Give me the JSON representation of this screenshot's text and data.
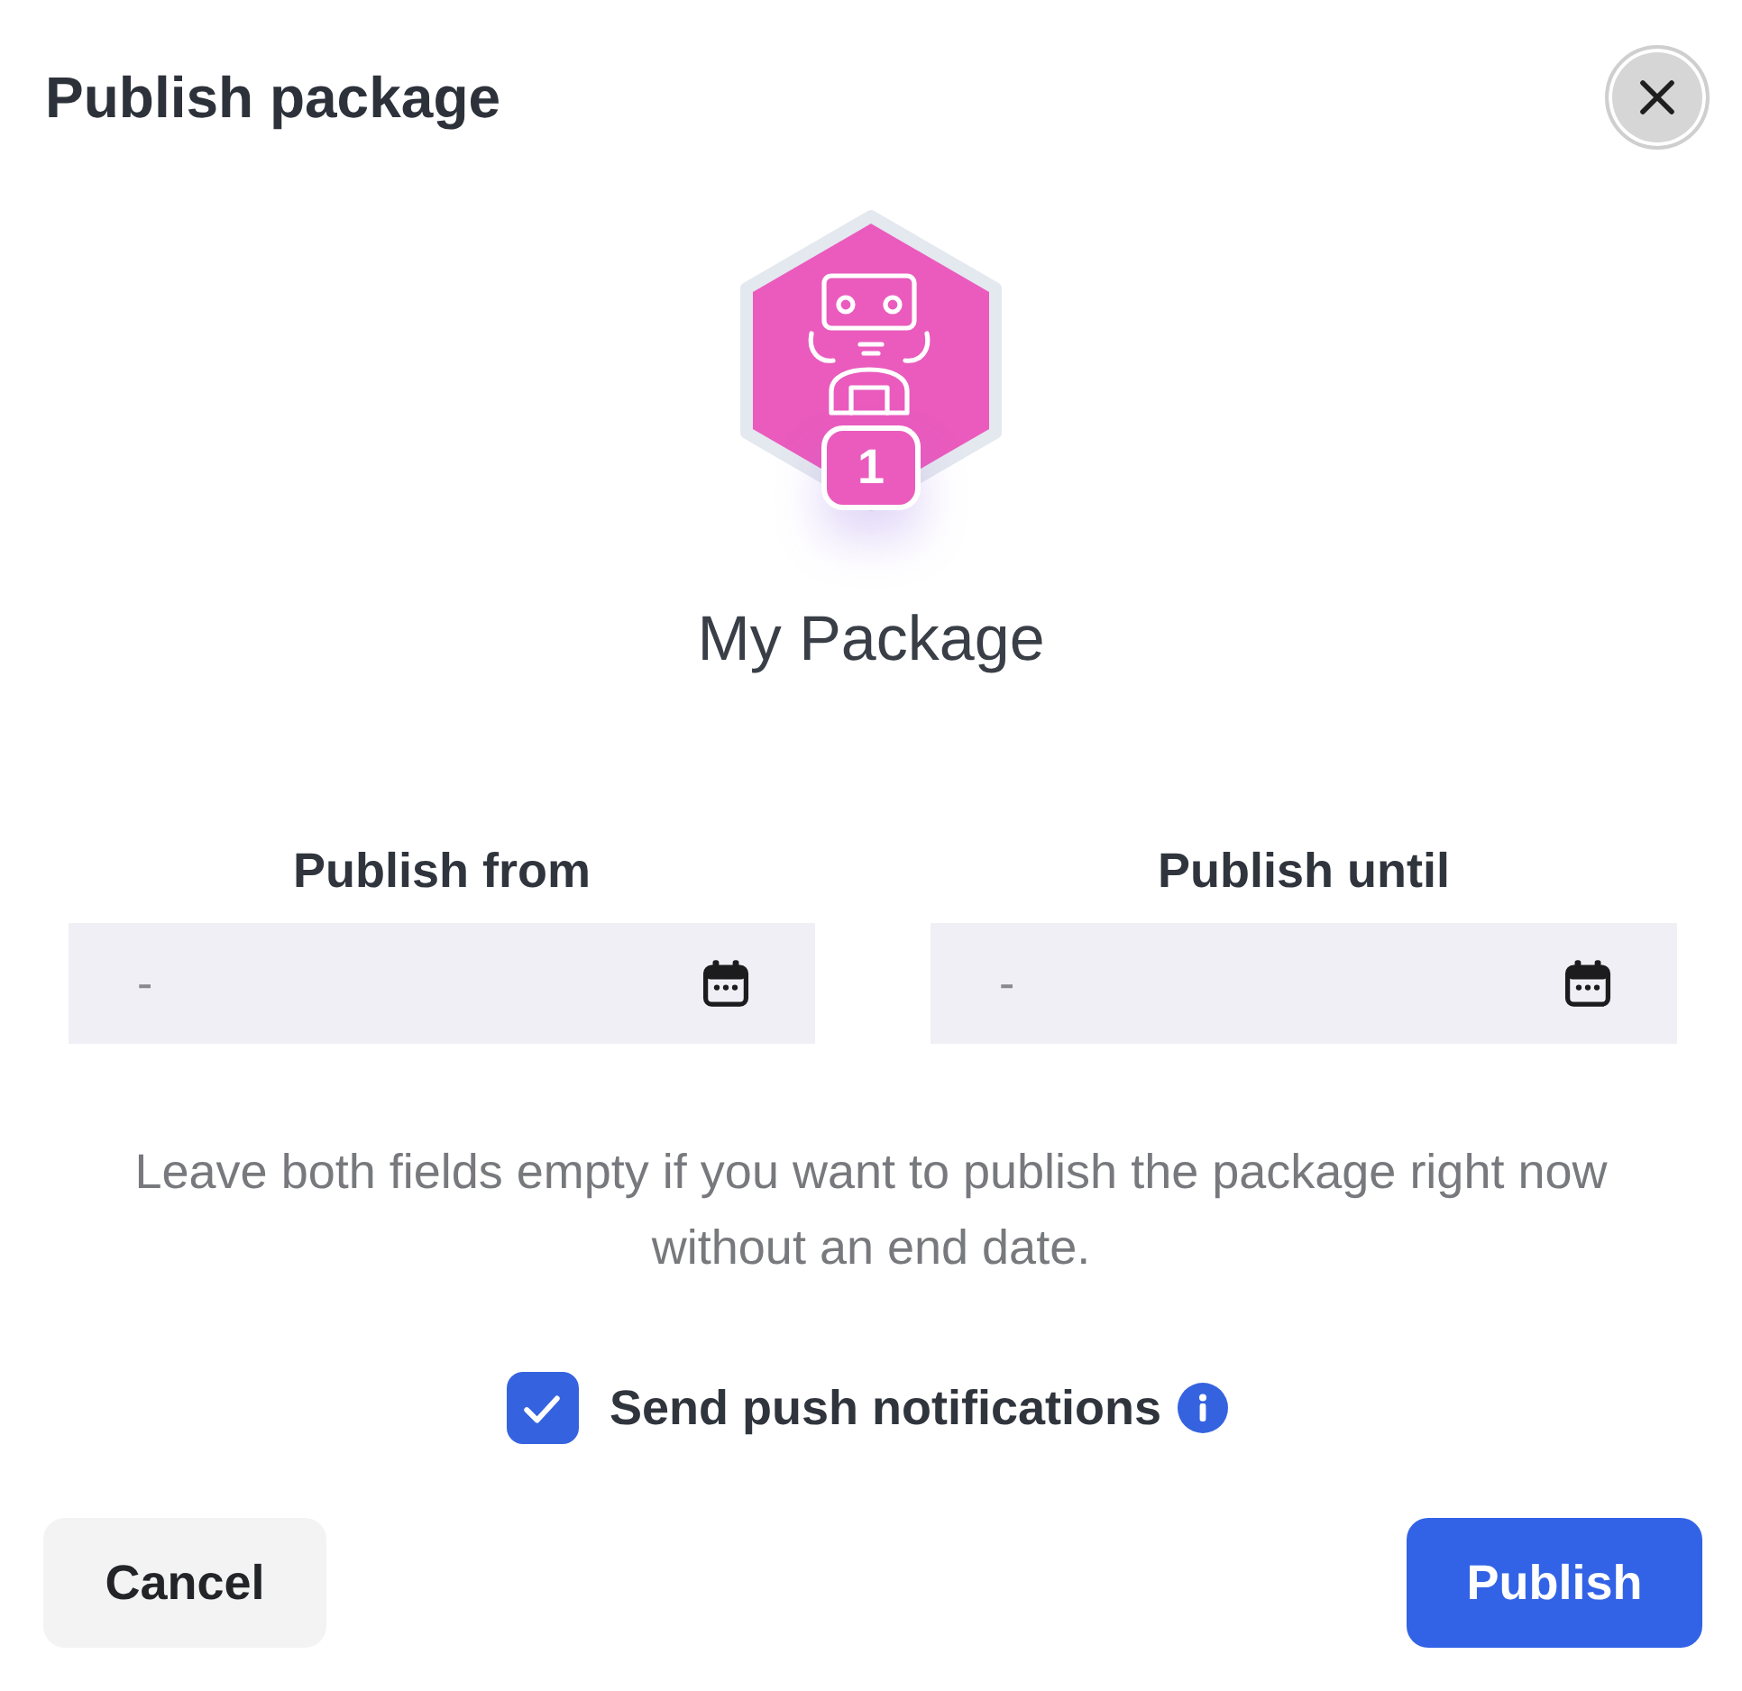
{
  "dialog": {
    "title": "Publish package"
  },
  "package": {
    "name": "My Package",
    "badge": "1"
  },
  "date_fields": [
    {
      "label": "Publish from",
      "placeholder": "-"
    },
    {
      "label": "Publish until",
      "placeholder": "-"
    }
  ],
  "hint": "Leave both fields empty if you want to publish the package right now without an end date.",
  "push_notifications": {
    "label": "Send push notifications",
    "checked": true
  },
  "buttons": [
    {
      "label": "Cancel",
      "kind": "secondary"
    },
    {
      "label": "Publish",
      "kind": "primary"
    }
  ]
}
